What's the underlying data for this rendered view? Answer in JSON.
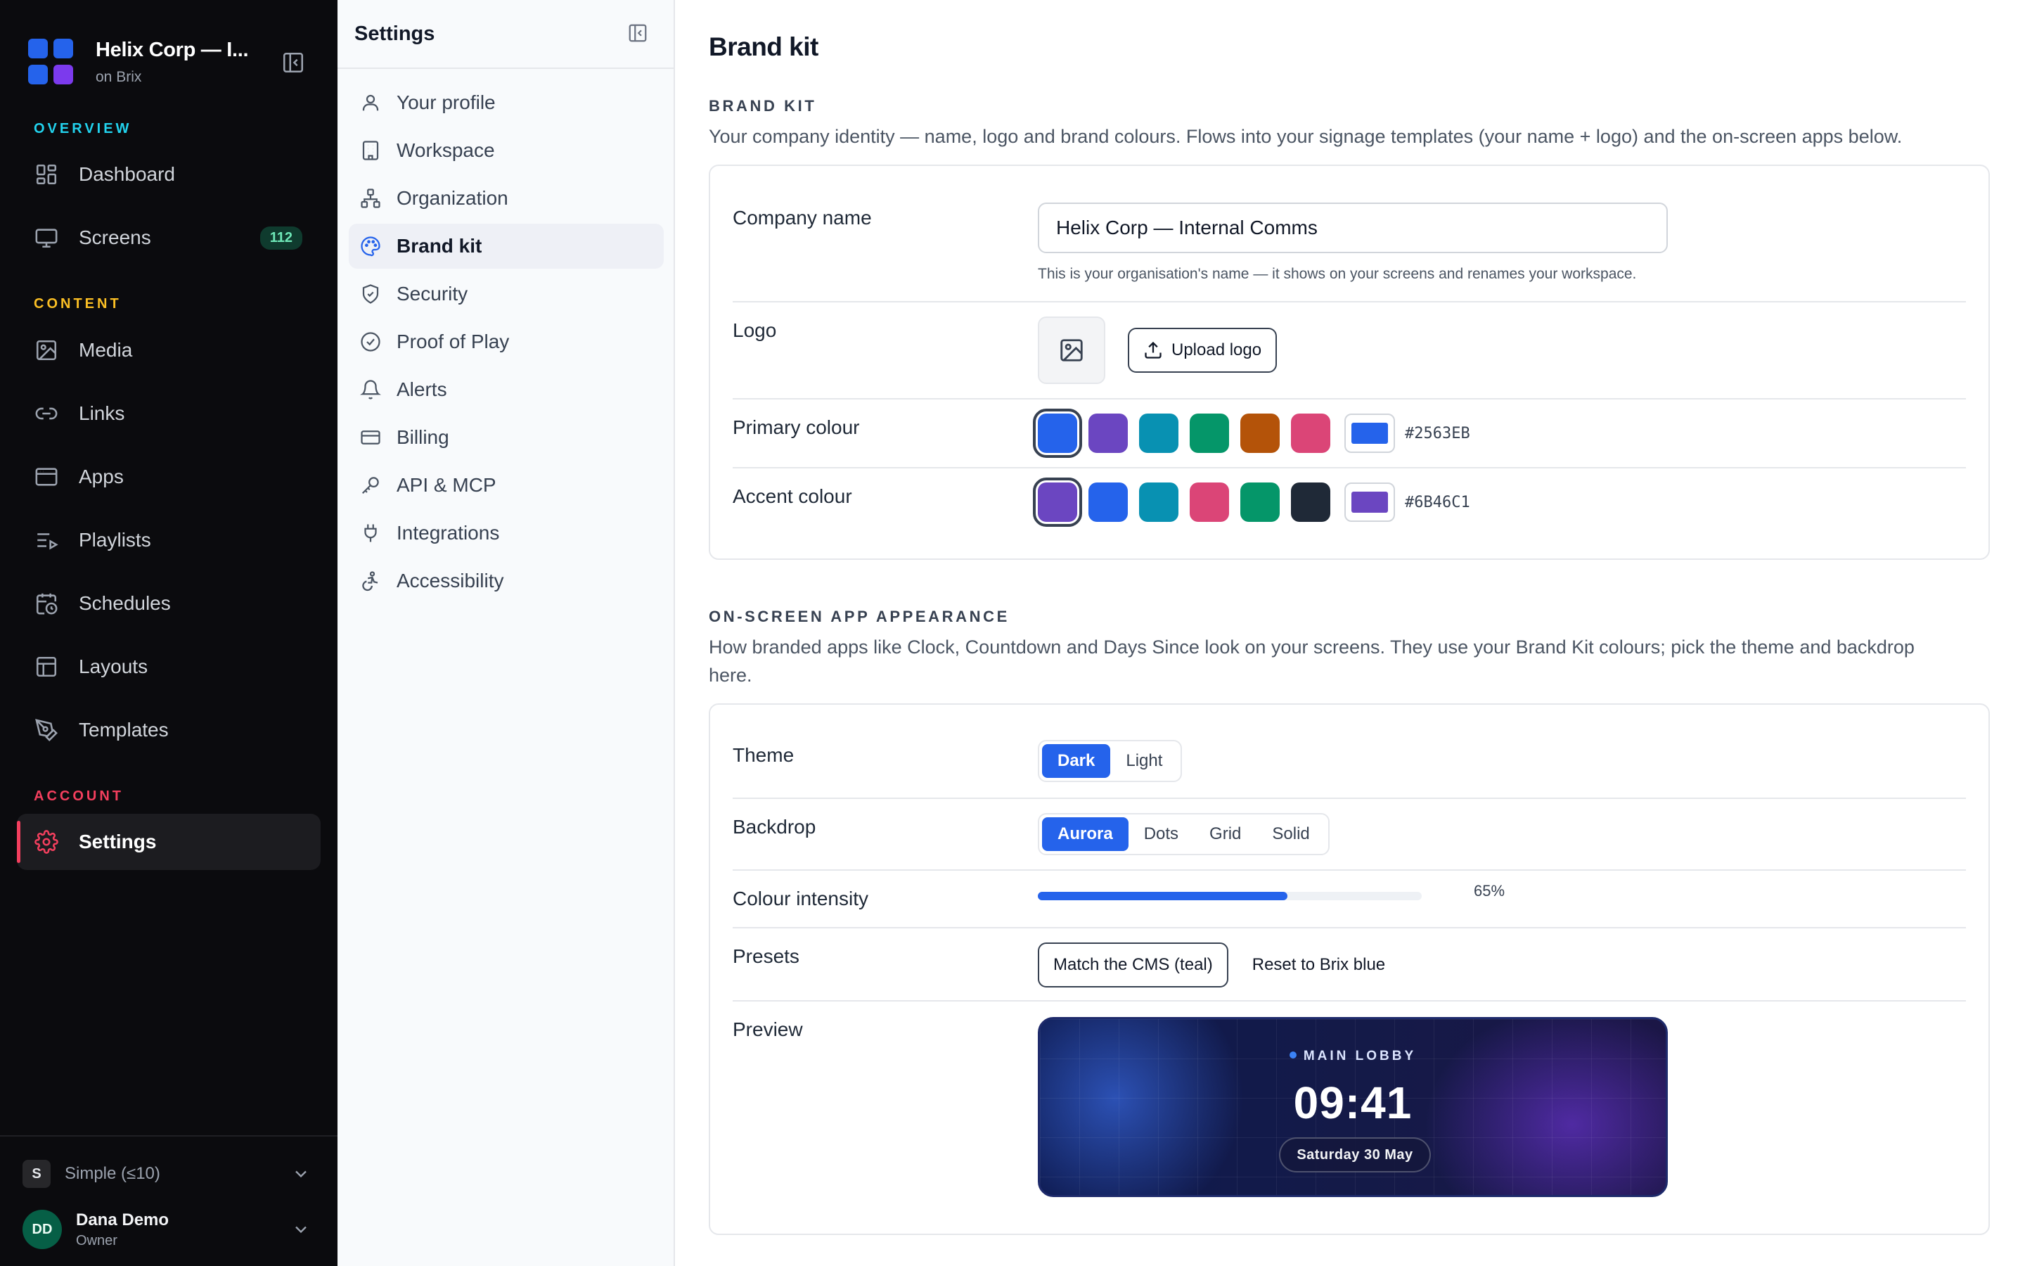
{
  "colors": {
    "accent_blue": "#2563EB",
    "accent_teal": "#22D3EE",
    "content_gold": "#FBBF24",
    "account_red": "#F43F5E"
  },
  "workspace": {
    "name": "Helix Corp — I...",
    "sub": "on Brix"
  },
  "sidebar": {
    "sections": [
      {
        "label": "OVERVIEW",
        "color": "#22D3EE"
      },
      {
        "label": "CONTENT",
        "color": "#FBBF24"
      },
      {
        "label": "ACCOUNT",
        "color": "#F43F5E"
      }
    ],
    "items": [
      {
        "label": "Dashboard",
        "icon": "dashboard-icon"
      },
      {
        "label": "Screens",
        "icon": "monitor-icon",
        "badge": "112"
      },
      {
        "label": "Media",
        "icon": "image-icon"
      },
      {
        "label": "Links",
        "icon": "link-icon"
      },
      {
        "label": "Apps",
        "icon": "browser-window-icon"
      },
      {
        "label": "Playlists",
        "icon": "playlist-icon"
      },
      {
        "label": "Schedules",
        "icon": "calendar-clock-icon"
      },
      {
        "label": "Layouts",
        "icon": "layout-icon"
      },
      {
        "label": "Templates",
        "icon": "pen-tool-icon"
      },
      {
        "label": "Settings",
        "icon": "gear-icon",
        "active": true
      }
    ],
    "plan": {
      "chip": "S",
      "label": "Simple (≤10)"
    },
    "user": {
      "initials": "DD",
      "name": "Dana Demo",
      "role": "Owner"
    }
  },
  "settings_nav": {
    "title": "Settings",
    "items": [
      {
        "label": "Your profile",
        "icon": "user-icon"
      },
      {
        "label": "Workspace",
        "icon": "building-icon"
      },
      {
        "label": "Organization",
        "icon": "org-chart-icon"
      },
      {
        "label": "Brand kit",
        "icon": "palette-icon",
        "active": true
      },
      {
        "label": "Security",
        "icon": "shield-icon"
      },
      {
        "label": "Proof of Play",
        "icon": "check-circle-icon"
      },
      {
        "label": "Alerts",
        "icon": "bell-icon"
      },
      {
        "label": "Billing",
        "icon": "credit-card-icon"
      },
      {
        "label": "API & MCP",
        "icon": "key-icon"
      },
      {
        "label": "Integrations",
        "icon": "plug-icon"
      },
      {
        "label": "Accessibility",
        "icon": "accessibility-icon"
      }
    ]
  },
  "page": {
    "title": "Brand kit"
  },
  "brand_kit": {
    "heading": "BRAND KIT",
    "description": "Your company identity — name, logo and brand colours. Flows into your signage templates (your name + logo) and the on-screen apps below.",
    "company_name": {
      "label": "Company name",
      "value": "Helix Corp — Internal Comms",
      "helper": "This is your organisation's name — it shows on your screens and renames your workspace."
    },
    "logo": {
      "label": "Logo",
      "upload_label": "Upload logo"
    },
    "primary_colour": {
      "label": "Primary colour",
      "swatches": [
        "#2563EB",
        "#6B46C1",
        "#0891B2",
        "#059669",
        "#B45309",
        "#DB4577"
      ],
      "selected_index": 0,
      "hex": "#2563EB"
    },
    "accent_colour": {
      "label": "Accent colour",
      "swatches": [
        "#6B46C1",
        "#2563EB",
        "#0891B2",
        "#DB4577",
        "#059669",
        "#1F2937"
      ],
      "selected_index": 0,
      "hex": "#6B46C1"
    }
  },
  "appearance": {
    "heading": "ON-SCREEN APP APPEARANCE",
    "description": "How branded apps like Clock, Countdown and Days Since look on your screens. They use your Brand Kit colours; pick the theme and backdrop here.",
    "theme": {
      "label": "Theme",
      "options": [
        "Dark",
        "Light"
      ],
      "selected": "Dark"
    },
    "backdrop": {
      "label": "Backdrop",
      "options": [
        "Aurora",
        "Dots",
        "Grid",
        "Solid"
      ],
      "selected": "Aurora"
    },
    "intensity": {
      "label": "Colour intensity",
      "value": 65,
      "display": "65%"
    },
    "presets": {
      "label": "Presets",
      "match_label": "Match the CMS (teal)",
      "reset_label": "Reset to Brix blue"
    },
    "preview": {
      "label": "Preview",
      "eyebrow": "MAIN LOBBY",
      "time": "09:41",
      "date": "Saturday 30 May"
    }
  }
}
